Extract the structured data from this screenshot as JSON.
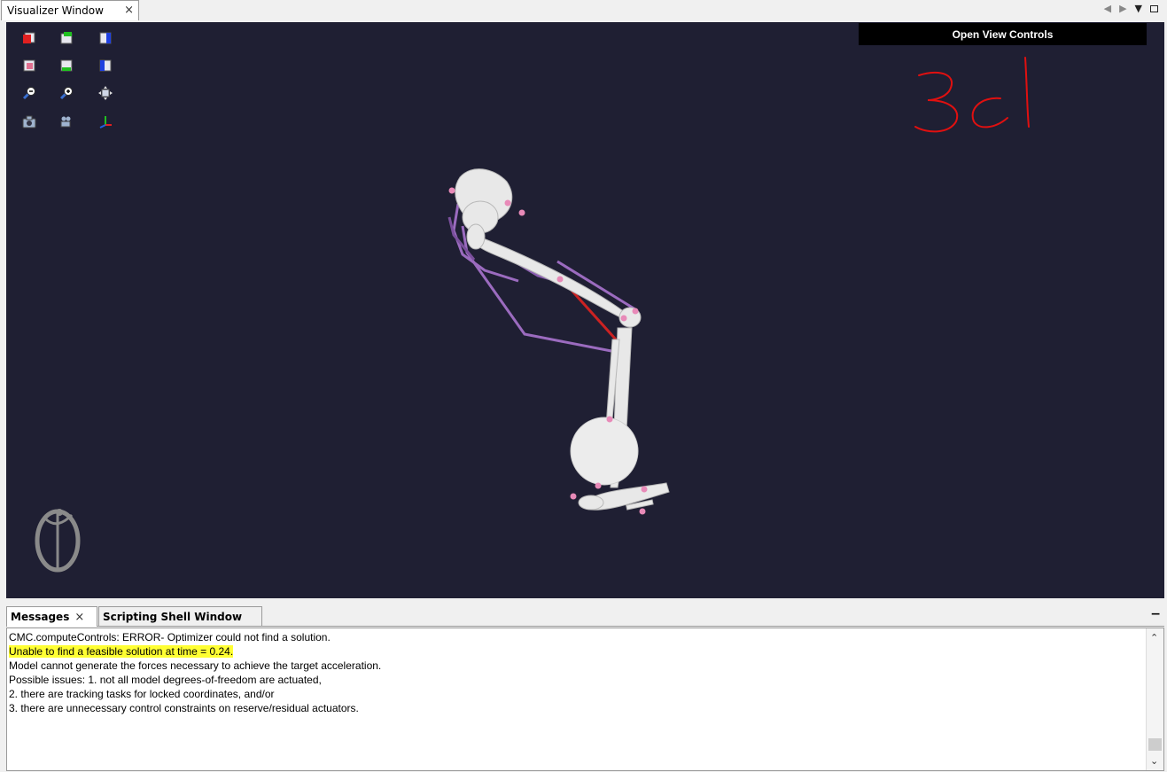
{
  "window": {
    "tab_label": "Visualizer Window",
    "close_glyph": "×"
  },
  "viewport": {
    "open_view_controls": "Open View Controls",
    "handwritten_annotation": "3d",
    "toolbar_icons": [
      "view-front-icon",
      "view-top-icon",
      "view-right-icon",
      "view-back-icon",
      "view-bottom-icon",
      "view-left-icon",
      "zoom-out-icon",
      "zoom-in-icon",
      "fit-view-icon",
      "snapshot-camera-icon",
      "record-movie-icon",
      "axes-toggle-icon"
    ]
  },
  "messages": {
    "tab_label": "Messages",
    "close_glyph": "×",
    "scripting_tab_label": "Scripting Shell Window",
    "minimize_glyph": "−",
    "lines": [
      "CMC.computeControls: ERROR- Optimizer could not find a solution.",
      "Unable to find a feasible solution at time = 0.24.",
      "Model cannot generate the forces necessary to achieve the target acceleration.",
      "Possible issues: 1. not all model degrees-of-freedom are actuated,",
      "2. there are tracking tasks for locked coordinates, and/or",
      "3. there are unnecessary control constraints on reserve/residual actuators."
    ],
    "highlight_color": "#ffff33"
  },
  "colors": {
    "viewport_bg": "#1f1f33",
    "muscle_purple": "#9b6bbf",
    "muscle_red": "#cc2222",
    "annotation_red": "#e01010",
    "marker_pink": "#e88ab8"
  }
}
